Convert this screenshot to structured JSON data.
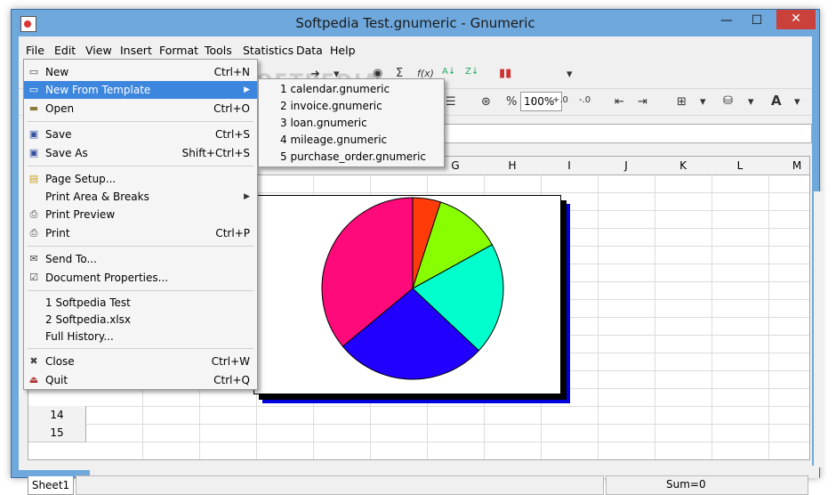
{
  "window": {
    "title": "Softpedia Test.gnumeric - Gnumeric",
    "minimize": "—",
    "maximize": "☐",
    "close": "✕"
  },
  "menubar": [
    "File",
    "Edit",
    "View",
    "Insert",
    "Format",
    "Tools",
    "Statistics",
    "Data",
    "Help"
  ],
  "toolbar": {
    "zoom": "100%"
  },
  "grid": {
    "columns": [
      "G",
      "H",
      "I",
      "J",
      "K",
      "L",
      "M"
    ],
    "rows": [
      "14",
      "15"
    ]
  },
  "file_menu": {
    "items": [
      {
        "label": "New",
        "accel": "Ctrl+N",
        "icon": "new-icon"
      },
      {
        "label": "New From Template",
        "accel": "",
        "icon": "template-icon",
        "submenu": true
      },
      {
        "label": "Open",
        "accel": "Ctrl+O",
        "icon": "folder-icon"
      },
      {
        "label": "Save",
        "accel": "Ctrl+S",
        "icon": "save-icon"
      },
      {
        "label": "Save As",
        "accel": "Shift+Ctrl+S",
        "icon": "save-as-icon"
      },
      {
        "label": "Page Setup...",
        "accel": "",
        "icon": "page-setup-icon"
      },
      {
        "label": "Print Area & Breaks",
        "accel": "",
        "icon": "",
        "submenu": true
      },
      {
        "label": "Print Preview",
        "accel": "",
        "icon": "print-preview-icon"
      },
      {
        "label": "Print",
        "accel": "Ctrl+P",
        "icon": "print-icon"
      },
      {
        "label": "Send To...",
        "accel": "",
        "icon": "mail-icon"
      },
      {
        "label": "Document Properties...",
        "accel": "",
        "icon": "properties-icon"
      },
      {
        "label": "1 Softpedia Test",
        "accel": "",
        "icon": ""
      },
      {
        "label": "2 Softpedia.xlsx",
        "accel": "",
        "icon": ""
      },
      {
        "label": "Full History...",
        "accel": "",
        "icon": ""
      },
      {
        "label": "Close",
        "accel": "Ctrl+W",
        "icon": "close-doc-icon"
      },
      {
        "label": "Quit",
        "accel": "Ctrl+Q",
        "icon": "quit-icon"
      }
    ]
  },
  "template_submenu": [
    "1 calendar.gnumeric",
    "2 invoice.gnumeric",
    "3 loan.gnumeric",
    "4 mileage.gnumeric",
    "5 purchase_order.gnumeric"
  ],
  "chart_data": {
    "type": "pie",
    "values": [
      5,
      12,
      20,
      27,
      36
    ],
    "colors": [
      "#ff3b0a",
      "#88ff00",
      "#00ffcc",
      "#2200ff",
      "#ff0a7a"
    ]
  },
  "status": {
    "sheet_tab": "Sheet1",
    "sum": "Sum=0"
  },
  "watermark": "SOFTPEDIA"
}
